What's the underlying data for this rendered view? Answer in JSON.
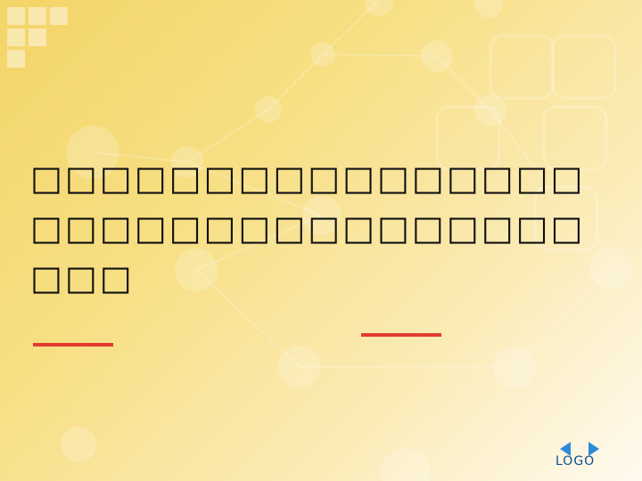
{
  "slide": {
    "text": "□□□□□□□□□□□□□□□□□□□□□□□□□□□□□□□□□□□",
    "logo": "LOGO"
  },
  "colors": {
    "background_start": "#f3d467",
    "background_end": "#fffaf0",
    "text": "#111111",
    "underline": "#e33a2f",
    "logo": "#0d4e8f"
  }
}
